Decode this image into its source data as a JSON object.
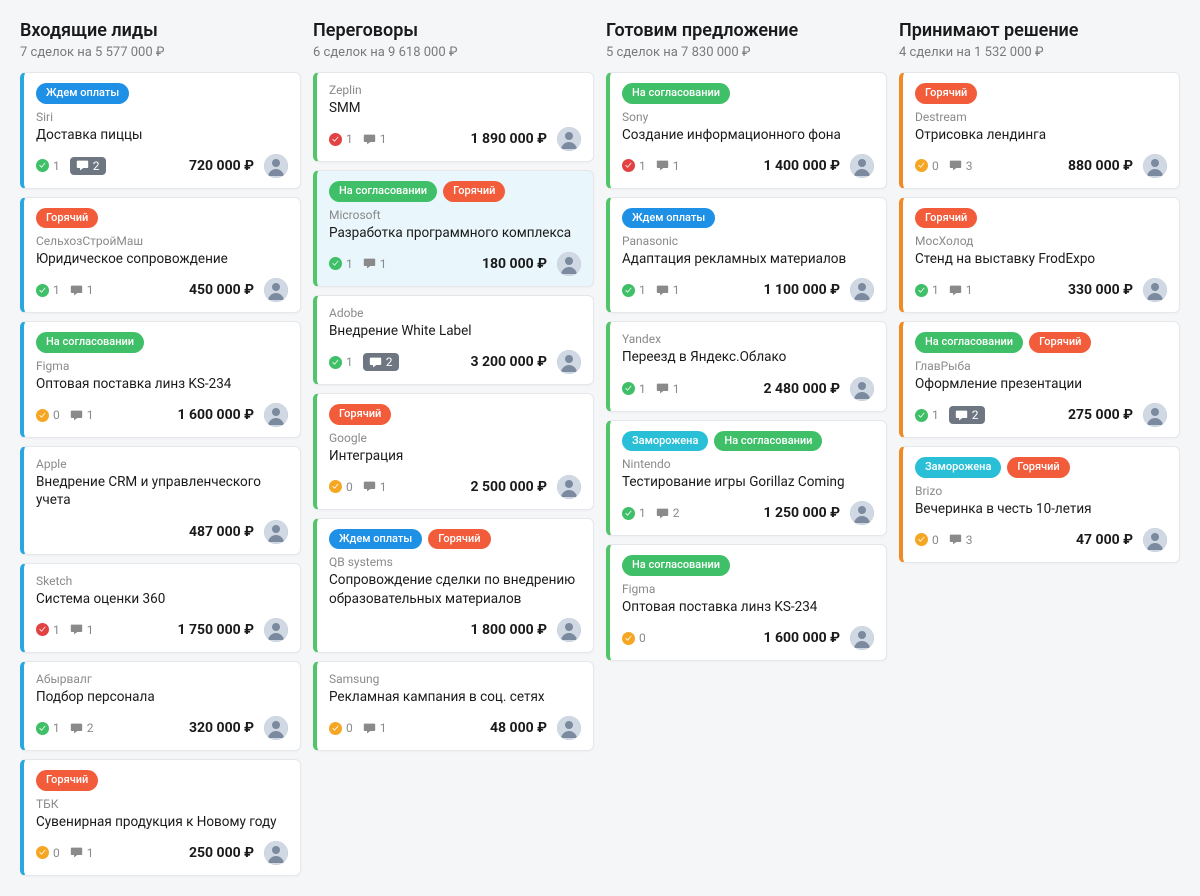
{
  "tag_labels": {
    "wait_payment": "Ждем оплаты",
    "hot": "Горячий",
    "approval": "На согласовании",
    "frozen": "Заморожена"
  },
  "columns": [
    {
      "title": "Входящие лиды",
      "subtitle": "7 сделок на 5 577 000 ₽",
      "cards": [
        {
          "stripe": "blue",
          "tags": [
            [
              "wait_payment",
              "blue"
            ]
          ],
          "company": "Siri",
          "title": "Доставка пиццы",
          "check": "green",
          "check_n": "1",
          "comments": "2",
          "comment_pill": true,
          "price": "720 000 ₽"
        },
        {
          "stripe": "blue",
          "tags": [
            [
              "hot",
              "orange"
            ]
          ],
          "company": "СельхозСтройМаш",
          "title": "Юридическое сопровождение",
          "check": "green",
          "check_n": "1",
          "comments": "1",
          "price": "450 000 ₽"
        },
        {
          "stripe": "blue",
          "tags": [
            [
              "approval",
              "green"
            ]
          ],
          "company": "Figma",
          "title": "Оптовая поставка линз KS-234",
          "check": "orange",
          "check_n": "0",
          "comments": "1",
          "price": "1 600 000 ₽"
        },
        {
          "stripe": "blue",
          "company": "Apple",
          "title": "Внедрение CRM и управленческого учета",
          "price": "487 000 ₽"
        },
        {
          "stripe": "blue",
          "company": "Sketch",
          "title": "Система оценки 360",
          "check": "red",
          "check_n": "1",
          "comments": "1",
          "price": "1 750 000 ₽"
        },
        {
          "stripe": "blue",
          "company": "Абырвалг",
          "title": "Подбор персонала",
          "check": "green",
          "check_n": "1",
          "comments": "2",
          "price": "320 000 ₽"
        },
        {
          "stripe": "blue",
          "tags": [
            [
              "hot",
              "orange"
            ]
          ],
          "company": "ТБК",
          "title": "Сувенирная продукция к Новому году",
          "check": "orange",
          "check_n": "0",
          "comments": "1",
          "price": "250 000 ₽"
        }
      ]
    },
    {
      "title": "Переговоры",
      "subtitle": "6 сделок на 9 618 000 ₽",
      "cards": [
        {
          "stripe": "green",
          "company": "Zeplin",
          "title": "SMM",
          "check": "red",
          "check_n": "1",
          "comments": "1",
          "price": "1 890 000 ₽"
        },
        {
          "stripe": "green",
          "bg": "blue",
          "tags": [
            [
              "approval",
              "green"
            ],
            [
              "hot",
              "orange"
            ]
          ],
          "company": "Microsoft",
          "title": "Разработка программного комплекса",
          "check": "green",
          "check_n": "1",
          "comments": "1",
          "price": "180 000 ₽"
        },
        {
          "stripe": "green",
          "company": "Adobe",
          "title": "Внедрение White Label",
          "check": "green",
          "check_n": "1",
          "comments": "2",
          "comment_pill": true,
          "price": "3 200 000 ₽"
        },
        {
          "stripe": "green",
          "tags": [
            [
              "hot",
              "orange"
            ]
          ],
          "company": "Google",
          "title": "Интеграция",
          "check": "orange",
          "check_n": "0",
          "comments": "1",
          "price": "2 500 000 ₽"
        },
        {
          "stripe": "green",
          "tags": [
            [
              "wait_payment",
              "blue"
            ],
            [
              "hot",
              "orange"
            ]
          ],
          "company": "QB systems",
          "title": "Сопровождение сделки по внедрению образовательных материалов",
          "price": "1 800 000 ₽"
        },
        {
          "stripe": "green",
          "company": "Samsung",
          "title": "Рекламная кампания в соц. сетях",
          "check": "orange",
          "check_n": "0",
          "comments": "1",
          "price": "48 000 ₽"
        }
      ]
    },
    {
      "title": "Готовим предложение",
      "subtitle": "5 сделок на 7 830 000 ₽",
      "cards": [
        {
          "stripe": "green",
          "tags": [
            [
              "approval",
              "green"
            ]
          ],
          "company": "Sony",
          "title": "Создание информационного фона",
          "check": "red",
          "check_n": "1",
          "comments": "1",
          "price": "1 400 000 ₽"
        },
        {
          "stripe": "green",
          "tags": [
            [
              "wait_payment",
              "blue"
            ]
          ],
          "company": "Panasonic",
          "title": "Адаптация рекламных материалов",
          "check": "green",
          "check_n": "1",
          "comments": "1",
          "price": "1 100 000 ₽"
        },
        {
          "stripe": "green",
          "company": "Yandex",
          "title": "Переезд в Яндекс.Облако",
          "check": "green",
          "check_n": "1",
          "comments": "1",
          "price": "2 480 000 ₽"
        },
        {
          "stripe": "green",
          "tags": [
            [
              "frozen",
              "cyan"
            ],
            [
              "approval",
              "green"
            ]
          ],
          "company": "Nintendo",
          "title": "Тестирование игры Gorillaz Coming",
          "check": "green",
          "check_n": "1",
          "comments": "2",
          "price": "1 250 000 ₽"
        },
        {
          "stripe": "green",
          "tags": [
            [
              "approval",
              "green"
            ]
          ],
          "company": "Figma",
          "title": "Оптовая поставка линз KS-234",
          "check": "orange",
          "check_n": "0",
          "price": "1 600 000 ₽"
        }
      ]
    },
    {
      "title": "Принимают решение",
      "subtitle": "4 сделки на 1 532 000 ₽",
      "cards": [
        {
          "stripe": "orange",
          "tags": [
            [
              "hot",
              "orange"
            ]
          ],
          "company": "Destream",
          "title": "Отрисовка лендинга",
          "check": "orange",
          "check_n": "0",
          "comments": "3",
          "price": "880 000 ₽"
        },
        {
          "stripe": "orange",
          "tags": [
            [
              "hot",
              "orange"
            ]
          ],
          "company": "МосХолод",
          "title": "Стенд на выставку FrodExpo",
          "check": "green",
          "check_n": "1",
          "comments": "1",
          "price": "330 000 ₽"
        },
        {
          "stripe": "orange",
          "tags": [
            [
              "approval",
              "green"
            ],
            [
              "hot",
              "orange"
            ]
          ],
          "company": "ГлавРыба",
          "title": "Оформление презентации",
          "check": "green",
          "check_n": "1",
          "comments": "2",
          "comment_pill": true,
          "price": "275 000 ₽"
        },
        {
          "stripe": "orange",
          "tags": [
            [
              "frozen",
              "cyan"
            ],
            [
              "hot",
              "orange"
            ]
          ],
          "company": "Brizo",
          "title": "Вечеринка в честь 10-летия",
          "check": "orange",
          "check_n": "0",
          "comments": "3",
          "price": "47 000 ₽"
        }
      ]
    }
  ]
}
